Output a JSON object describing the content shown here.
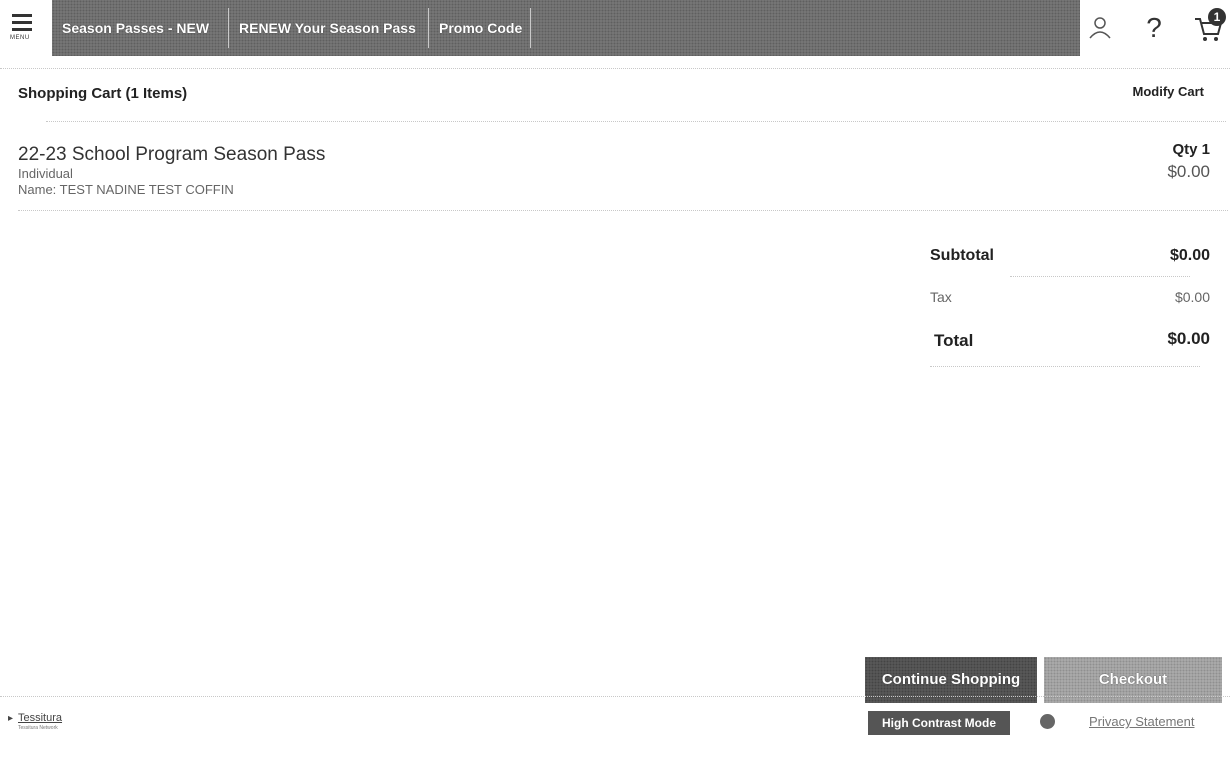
{
  "header": {
    "menu_label": "MENU",
    "nav": [
      "Season Passes - NEW",
      "RENEW Your Season Pass",
      "Promo Code"
    ],
    "help_glyph": "?",
    "cart_count": "1"
  },
  "cart": {
    "title": "Shopping Cart  (1 Items)",
    "modify_label": "Modify Cart",
    "item": {
      "name": "22-23 School Program Season Pass",
      "type": "Individual",
      "person": "Name: TEST NADINE TEST COFFIN",
      "qty": "Qty  1",
      "price": "$0.00"
    },
    "totals": {
      "subtotal_label": "Subtotal",
      "subtotal_value": "$0.00",
      "tax_label": "Tax",
      "tax_value": "$0.00",
      "total_label": "Total",
      "total_value": "$0.00"
    }
  },
  "actions": {
    "continue_label": "Continue Shopping",
    "checkout_label": "Checkout"
  },
  "footer": {
    "logo_text": "Tessitura",
    "logo_tagline": "Tessitura Network",
    "high_contrast_label": "High Contrast Mode",
    "privacy_label": "Privacy Statement"
  },
  "colors": {
    "nav_bg": "#7a7a7a",
    "continue_bg": "#5b5b5b",
    "checkout_bg": "#aeaeae",
    "high_contrast_bg": "#555555"
  }
}
